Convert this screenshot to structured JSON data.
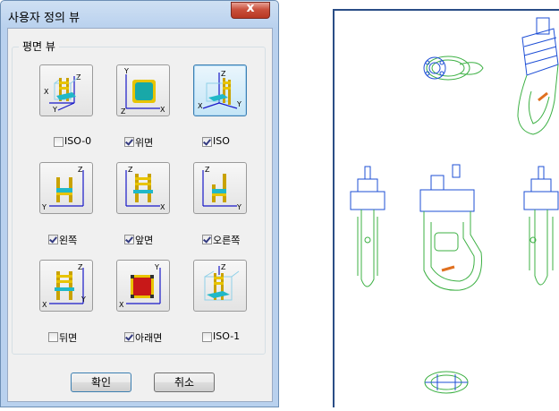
{
  "dialog": {
    "title": "사용자 정의 뷰",
    "close_glyph": "x",
    "group_label": "평면 뷰",
    "views": [
      {
        "label": "ISO-0",
        "checked": false,
        "selected": false,
        "icon": "iso-chair-icon"
      },
      {
        "label": "위면",
        "checked": true,
        "selected": false,
        "icon": "top-chair-icon"
      },
      {
        "label": "ISO",
        "checked": true,
        "selected": true,
        "icon": "iso-chair-icon"
      },
      {
        "label": "왼쪽",
        "checked": true,
        "selected": false,
        "icon": "left-chair-icon"
      },
      {
        "label": "앞면",
        "checked": true,
        "selected": false,
        "icon": "front-chair-icon"
      },
      {
        "label": "오른쪽",
        "checked": true,
        "selected": false,
        "icon": "right-chair-icon"
      },
      {
        "label": "뒤면",
        "checked": false,
        "selected": false,
        "icon": "back-chair-icon"
      },
      {
        "label": "아래면",
        "checked": true,
        "selected": false,
        "icon": "bottom-chair-icon"
      },
      {
        "label": "ISO-1",
        "checked": false,
        "selected": false,
        "icon": "iso-chair-icon"
      }
    ],
    "axes": {
      "x": "X",
      "y": "Y",
      "z": "Z"
    },
    "ok_label": "확인",
    "cancel_label": "취소"
  },
  "colors": {
    "cad_green": "#3cb043",
    "cad_blue": "#1e4fd6",
    "accent_orange": "#e07020",
    "axis_blue": "#1818c8"
  }
}
